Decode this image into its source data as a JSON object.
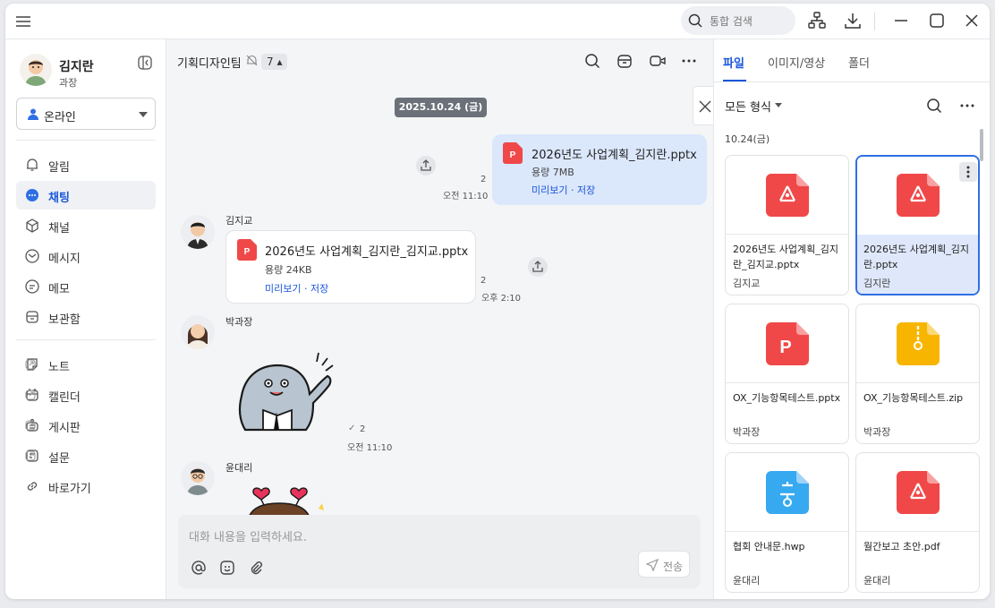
{
  "topbar": {
    "search_placeholder": "통합 검색",
    "icons": [
      "menu-icon",
      "search-icon",
      "org-chart-icon",
      "download-icon",
      "minimize-icon",
      "maximize-icon",
      "close-icon"
    ]
  },
  "profile": {
    "name": "김지란",
    "rank": "과장",
    "status": "온라인"
  },
  "sidebar": {
    "items": [
      {
        "label": "알림",
        "icon": "bell-icon",
        "active": false
      },
      {
        "label": "채팅",
        "icon": "chat-icon",
        "active": true
      },
      {
        "label": "채널",
        "icon": "channel-icon",
        "active": false
      },
      {
        "label": "메시지",
        "icon": "mail-icon",
        "active": false
      },
      {
        "label": "메모",
        "icon": "memo-icon",
        "active": false
      },
      {
        "label": "보관함",
        "icon": "archive-icon",
        "active": false
      }
    ],
    "external_items": [
      {
        "label": "노트",
        "icon": "note-icon"
      },
      {
        "label": "캘린더",
        "icon": "calendar-icon"
      },
      {
        "label": "게시판",
        "icon": "board-icon"
      },
      {
        "label": "설문",
        "icon": "survey-icon"
      },
      {
        "label": "바로가기",
        "icon": "link-icon"
      }
    ]
  },
  "chat": {
    "room_title": "기획디자인팀",
    "member_count": "7",
    "date_divider": "2025.10.24 (금)",
    "messages": [
      {
        "sender": "",
        "file_name": "2026년도 사업계획_김지란.pptx",
        "size": "용량 7MB",
        "links": "미리보기 · 저장",
        "read_count": "2",
        "time": "오전 11:10"
      },
      {
        "sender": "김지교",
        "file_name": "2026년도 사업계획_김지란_김지교.pptx",
        "size": "용량 24KB",
        "links": "미리보기 · 저장",
        "read_count": "2",
        "time": "오후 2:10"
      },
      {
        "sender": "박과장",
        "read_count": "2",
        "time": "오전 11:10"
      },
      {
        "sender": "윤대리"
      }
    ],
    "composer_placeholder": "대화 내용을 입력하세요.",
    "send_label": "전송"
  },
  "files_panel": {
    "tabs": [
      "파일",
      "이미지/영상",
      "폴더"
    ],
    "active_tab": "파일",
    "format_filter": "모든 형식",
    "date_group": "10.24(금)",
    "files": [
      {
        "name": "2026년도 사업계획_김지란_김지교.pptx",
        "owner": "김지교",
        "type": "pdf",
        "color": "#f04848",
        "selected": false
      },
      {
        "name": "2026년도 사업계획_김지란.pptx",
        "owner": "김지란",
        "type": "pdf",
        "color": "#f04848",
        "selected": true
      },
      {
        "name": "OX_기능항목테스트.pptx",
        "owner": "박과장",
        "type": "ppt",
        "color": "#f04848",
        "selected": false
      },
      {
        "name": "OX_기능항목테스트.zip",
        "owner": "박과장",
        "type": "zip",
        "color": "#f8b500",
        "selected": false
      },
      {
        "name": "협회 안내문.hwp",
        "owner": "윤대리",
        "type": "hwp",
        "color": "#36a9f0",
        "selected": false
      },
      {
        "name": "월간보고 초안.pdf",
        "owner": "윤대리",
        "type": "pdf",
        "color": "#f04848",
        "selected": false
      }
    ]
  }
}
